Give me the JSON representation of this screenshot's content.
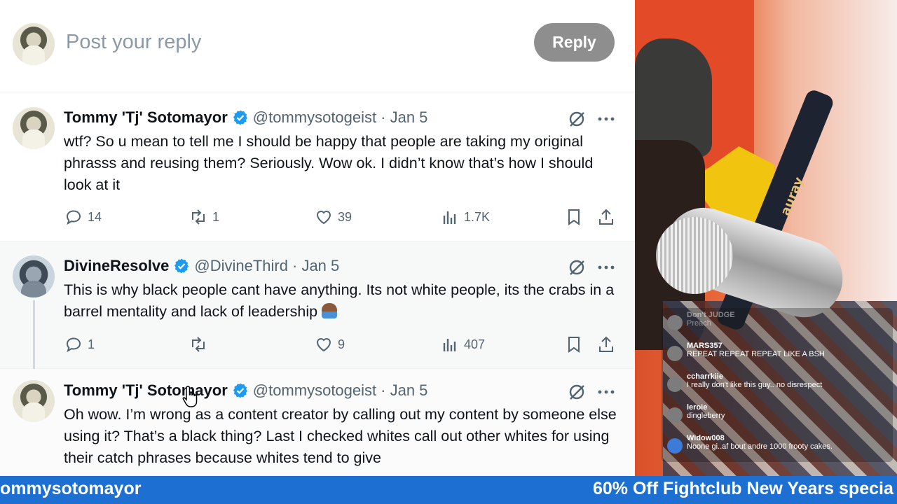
{
  "composer": {
    "placeholder": "Post your reply",
    "reply_label": "Reply"
  },
  "tweets": [
    {
      "name": "Tommy 'Tj' Sotomayor",
      "handle": "@tommysotogeist",
      "date": "· Jan 5",
      "text": "wtf? So u mean to tell me I should be happy that people are taking my original phrasss and reusing them? Seriously.   Wow ok. I didn’t know that’s how I should look at it",
      "replies": "14",
      "reposts": "1",
      "likes": "39",
      "views": "1.7K"
    },
    {
      "name": "DivineResolve",
      "handle": "@DivineThird",
      "date": "· Jan 5",
      "text": "This is why black people cant have anything. Its not white people, its the crabs in a barrel mentality and lack of leadership",
      "replies": "1",
      "reposts": "",
      "likes": "9",
      "views": "407"
    },
    {
      "name": "Tommy 'Tj' Sotomayor",
      "handle": "@tommysotogeist",
      "date": "· Jan 5",
      "text": "Oh wow. I’m wrong as a content creator by calling out my content by someone else using it?   That’s a black thing?   Last I checked whites call out other whites for using their catch phrases because whites tend to give"
    }
  ],
  "chat": [
    {
      "user": "Don't JUDGE",
      "msg": "Preach"
    },
    {
      "user": "MARS357",
      "msg": "REPEAT REPEAT REPEAT LIKE A BSH"
    },
    {
      "user": "ccharrkiie",
      "msg": "I really don't like this guy.. no disrespect"
    },
    {
      "user": "leroie",
      "msg": "dingleberry"
    },
    {
      "user": "Widow008",
      "msg": "Noone gi..af bout andre 1000 frooty cakes."
    }
  ],
  "stream": {
    "mic_brand": "auray"
  },
  "ticker": {
    "left": "ommysotomayor",
    "right": "60% Off Fightclub New Years specia"
  },
  "colors": {
    "verified": "#1d9bf0",
    "ticker_bg": "#1d6fd1",
    "reply_button": "#8e8e8e"
  }
}
